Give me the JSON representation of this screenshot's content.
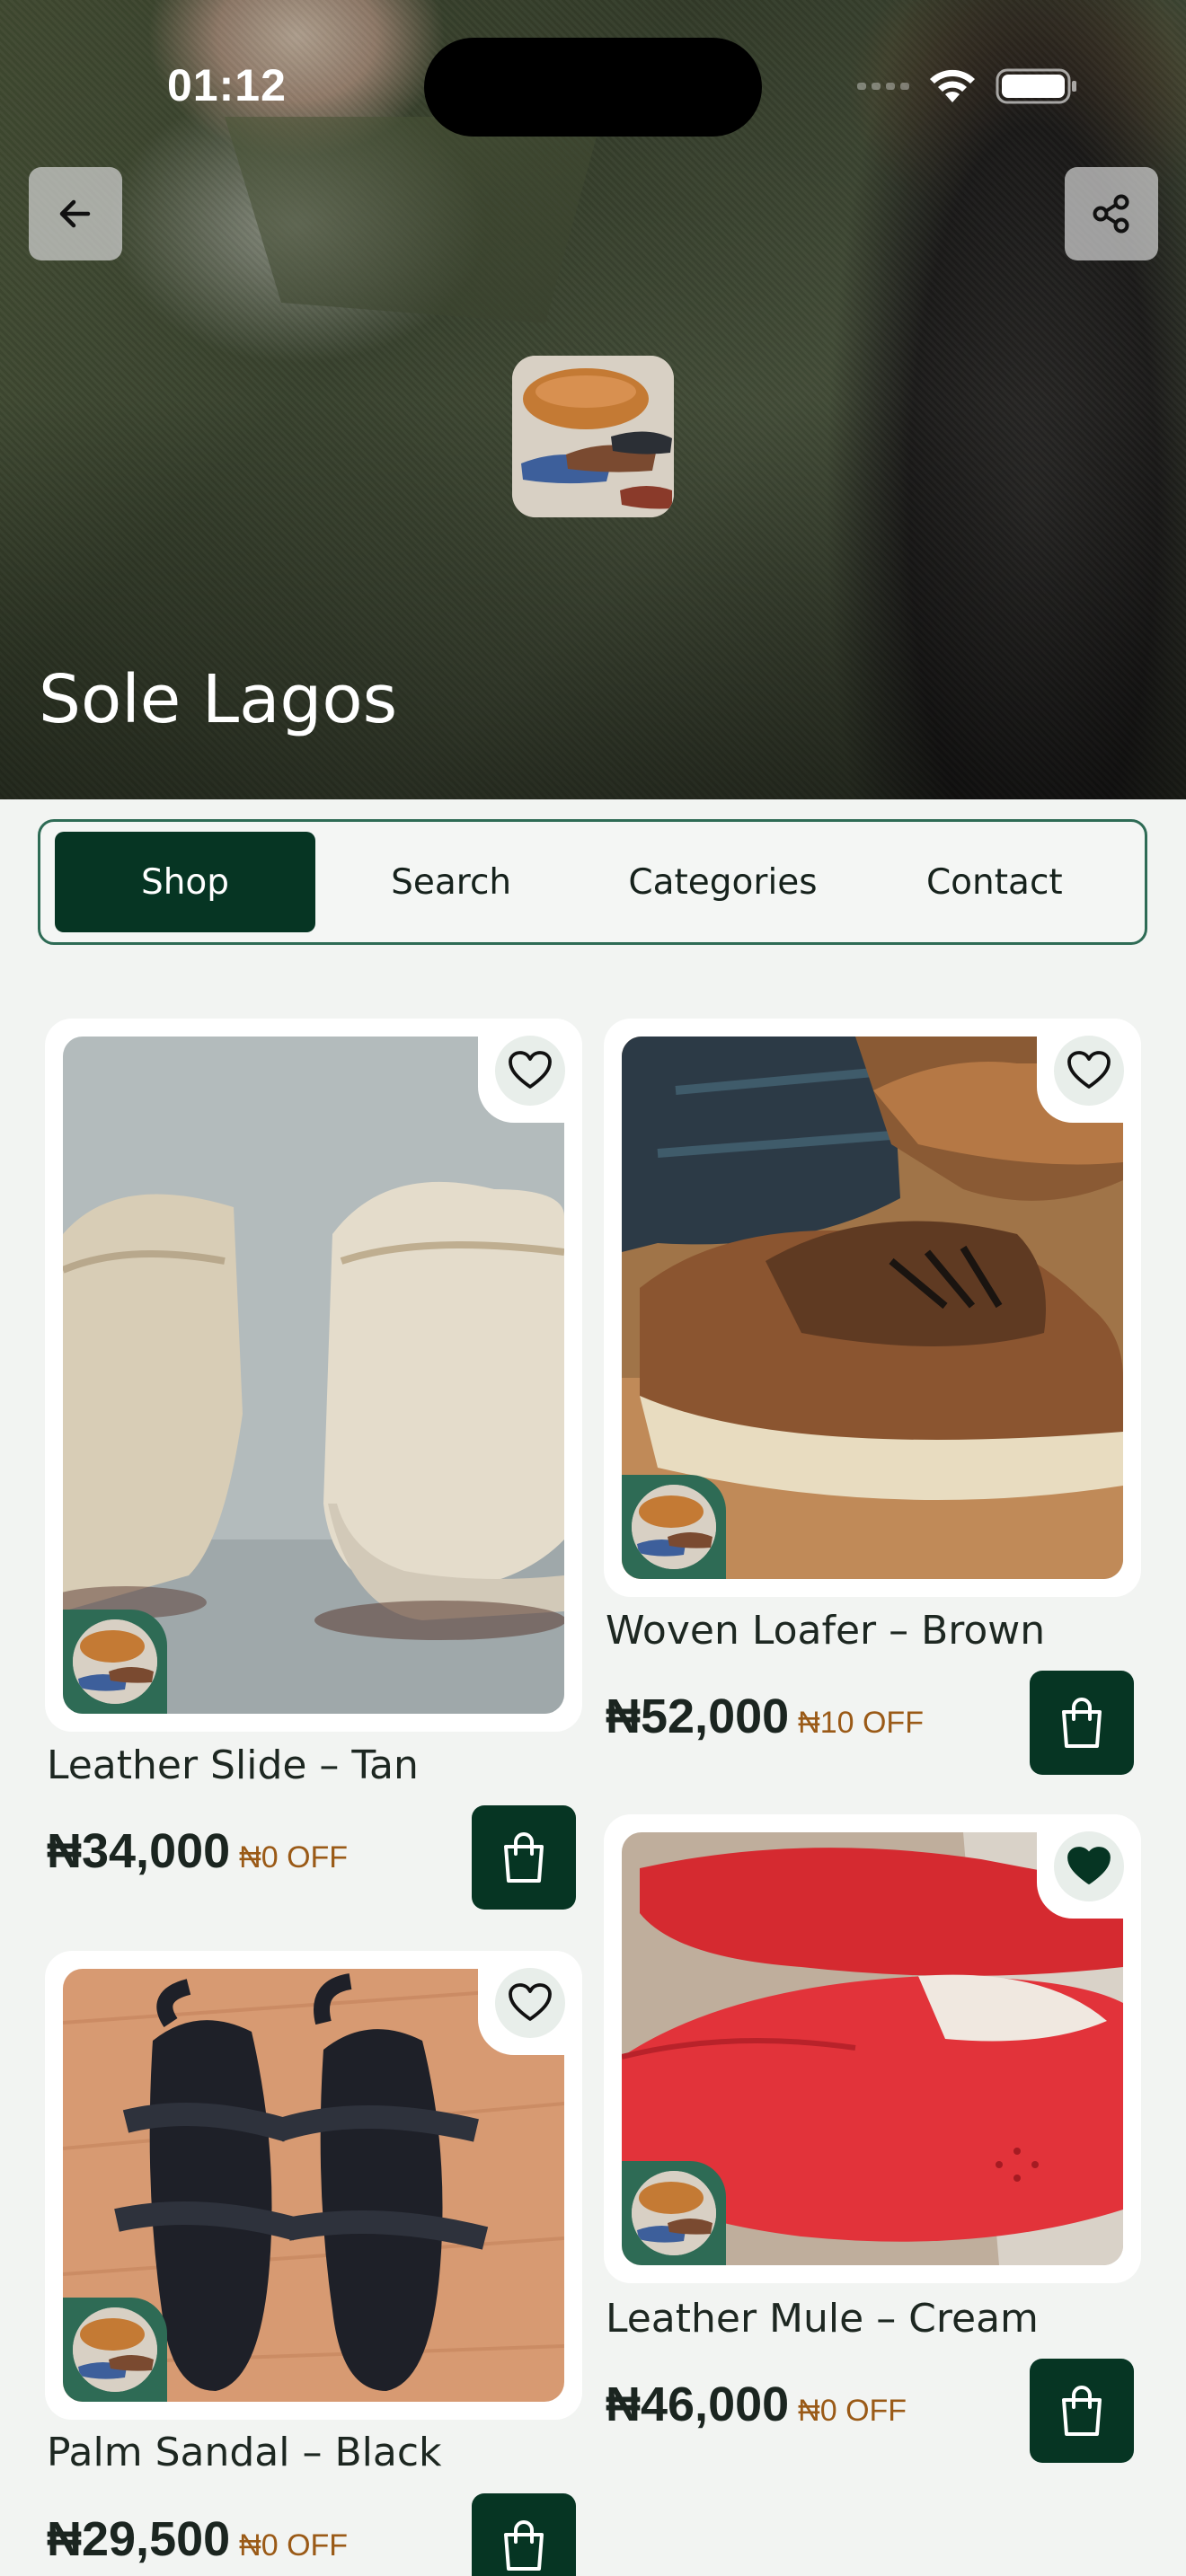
{
  "status_bar": {
    "time": "01:12"
  },
  "store": {
    "name": "Sole Lagos"
  },
  "nav": {
    "back_icon": "arrow-left-icon",
    "share_icon": "share-icon"
  },
  "tabs": [
    {
      "label": "Shop",
      "active": true
    },
    {
      "label": "Search",
      "active": false
    },
    {
      "label": "Categories",
      "active": false
    },
    {
      "label": "Contact",
      "active": false
    }
  ],
  "products": [
    {
      "name": "Leather Slide – Tan",
      "price": "₦34,000",
      "discount": "₦0 OFF",
      "favorited": false
    },
    {
      "name": "Woven Loafer – Brown",
      "price": "₦52,000",
      "discount": "₦10 OFF",
      "favorited": false
    },
    {
      "name": "Palm Sandal – Black",
      "price": "₦29,500",
      "discount": "₦0 OFF",
      "favorited": false
    },
    {
      "name": "Leather Mule – Cream",
      "price": "₦46,000",
      "discount": "₦0 OFF",
      "favorited": true
    }
  ],
  "colors": {
    "brand_dark": "#063523",
    "brand_accent": "#2e6b55",
    "discount": "#9a5a17",
    "background": "#f2f4f2"
  }
}
